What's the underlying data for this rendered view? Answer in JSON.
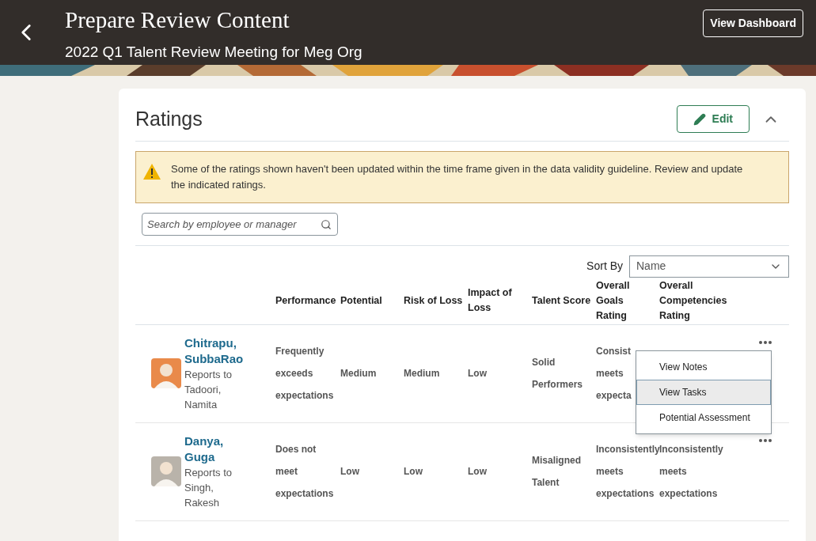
{
  "header": {
    "title": "Prepare Review Content",
    "subtitle": "2022 Q1 Talent Review Meeting for Meg Org",
    "action": "View Dashboard"
  },
  "section": {
    "title": "Ratings",
    "edit": "Edit",
    "expanded": true
  },
  "warning": "Some of the ratings shown haven't been updated within the time frame given in the data validity guideline. Review and update the indicated ratings.",
  "search": {
    "placeholder": "Search by employee or manager"
  },
  "sort": {
    "label": "Sort By",
    "value": "Name"
  },
  "columns": [
    "Performance",
    "Potential",
    "Risk of Loss",
    "Impact of Loss",
    "Talent Score",
    "Overall Goals Rating",
    "Overall Competencies Rating"
  ],
  "rows": [
    {
      "name": "Chitrapu, SubbaRao",
      "reports": "Reports to Tadoori, Namita",
      "cells": [
        "Frequently exceeds expectations",
        "Medium",
        "Medium",
        "Low",
        "Solid Performers",
        "Consist meets expecta",
        ""
      ],
      "menu": [
        {
          "label": "View Notes",
          "selected": false
        },
        {
          "label": "View Tasks",
          "selected": true
        },
        {
          "label": "Potential Assessment",
          "selected": false
        }
      ]
    },
    {
      "name": "Danya, Guga",
      "reports": "Reports to Singh, Rakesh",
      "cells": [
        "Does not meet expectations",
        "Low",
        "Low",
        "Low",
        "Misaligned Talent",
        "Inconsistently meets expectations",
        "Inconsistently meets expectations"
      ]
    }
  ]
}
